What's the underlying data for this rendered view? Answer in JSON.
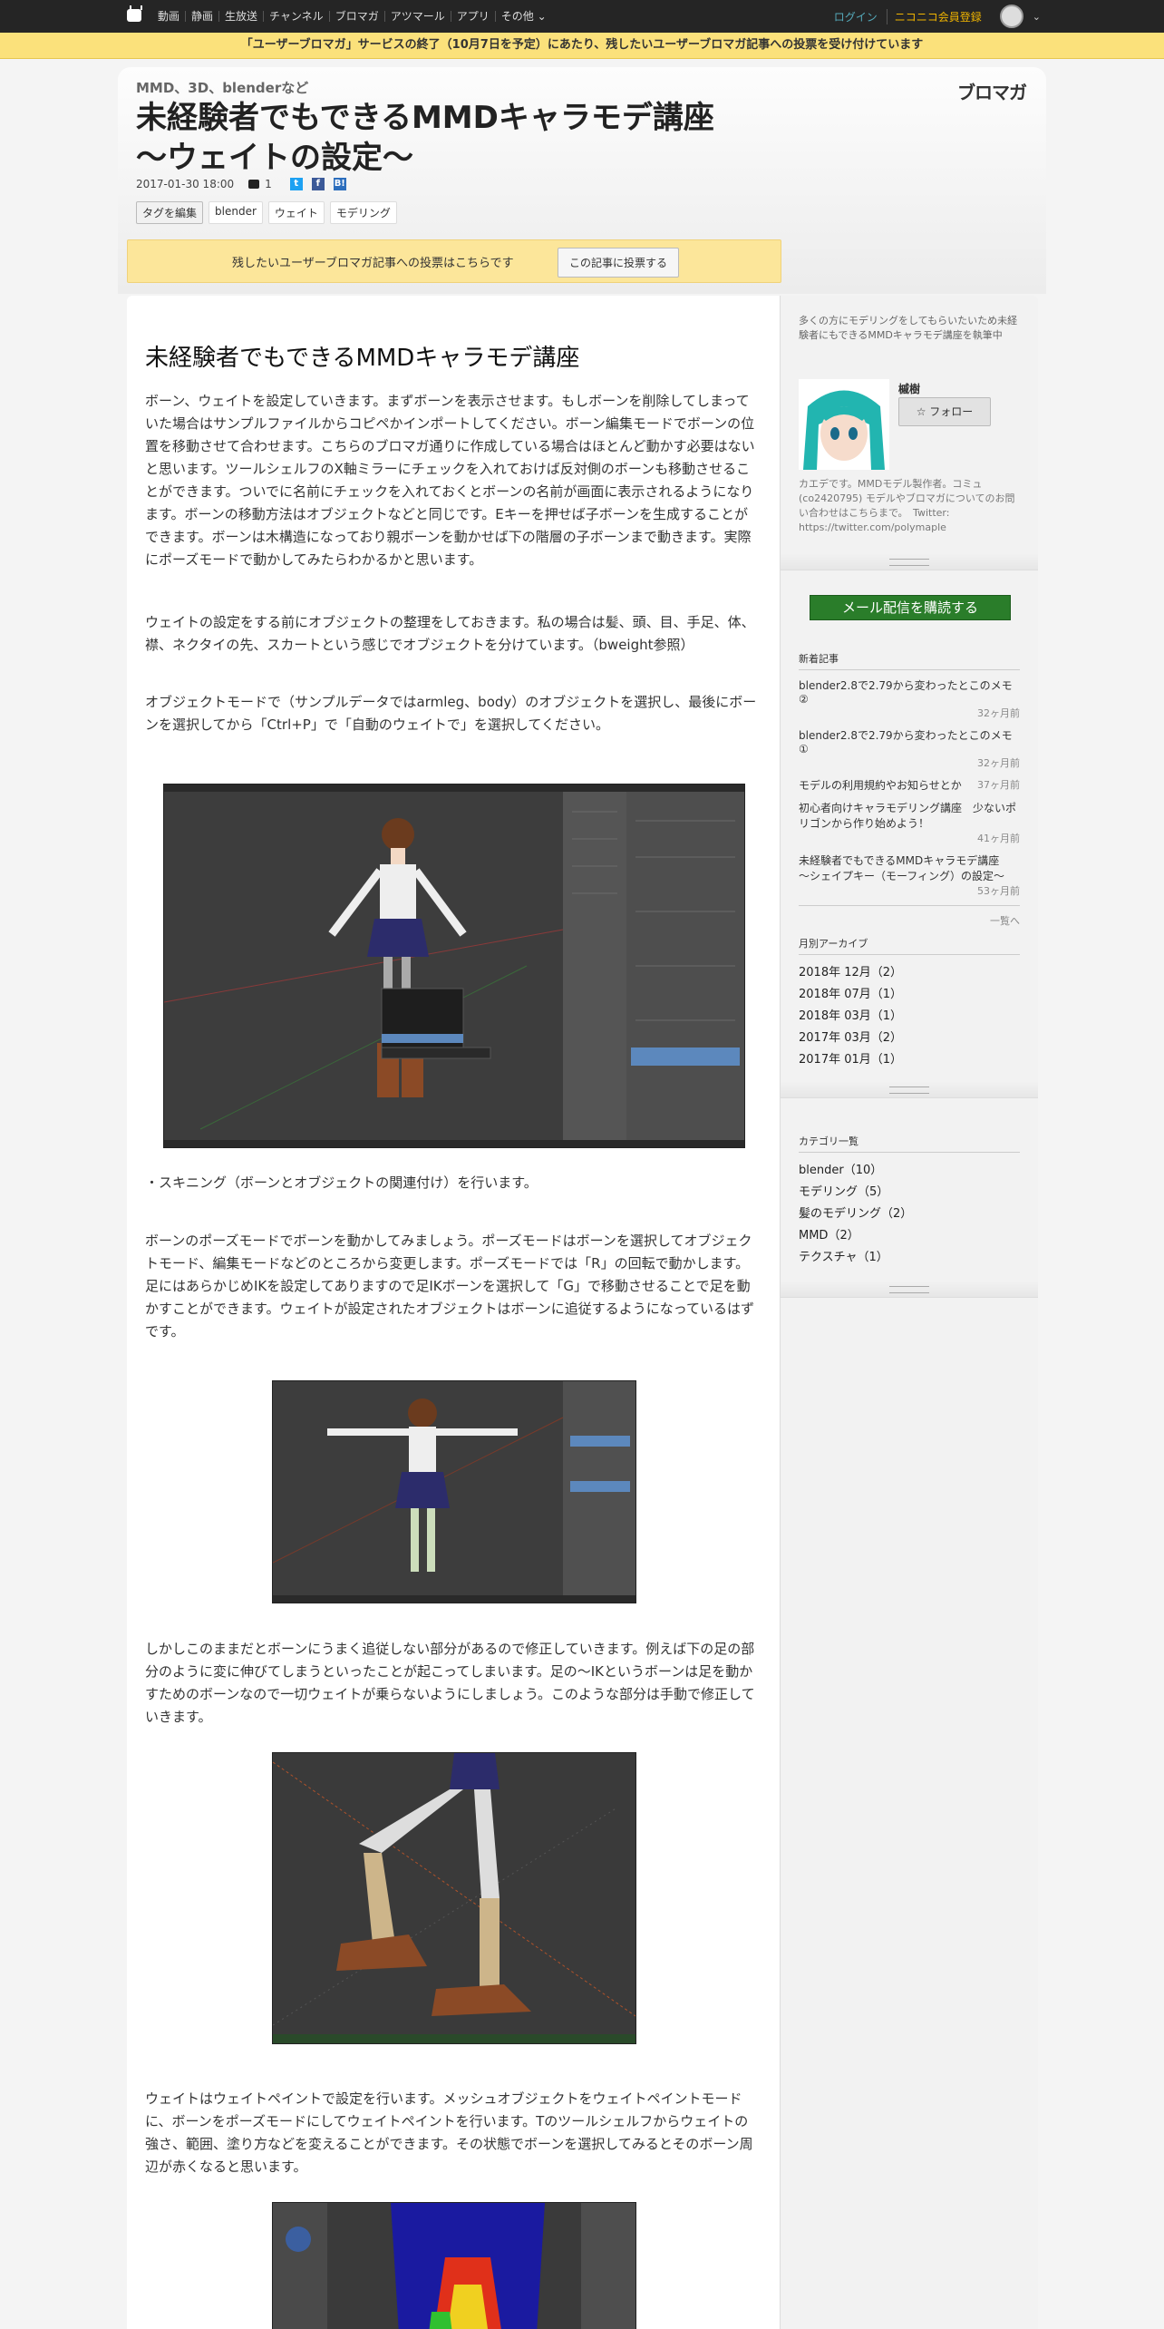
{
  "nav": {
    "links": [
      "動画",
      "静画",
      "生放送",
      "チャンネル",
      "ブロマガ",
      "アツマール",
      "アプリ",
      "その他"
    ],
    "login": "ログイン",
    "signup": "ニコニコ会員登録"
  },
  "notice": "「ユーザーブロマガ」サービスの終了（10月7日を予定）にあたり、残したいユーザーブロマガ記事への投票を受け付けています",
  "header": {
    "kicker": "MMD、3D、blenderなど",
    "logo": "ブロマガ",
    "title": "未経験者でもできるMMDキャラモデ講座　～ウェイトの設定～",
    "date": "2017-01-30 18:00",
    "comments": "1",
    "share": {
      "twitter": "t",
      "facebook": "f",
      "hatena": "B!"
    },
    "tag_edit": "タグを編集",
    "tags": [
      "blender",
      "ウェイト",
      "モデリング"
    ]
  },
  "vote": {
    "text": "残したいユーザーブロマガ記事への投票はこちらです",
    "button": "この記事に投票する"
  },
  "article": {
    "heading": "未経験者でもできるMMDキャラモデ講座",
    "p1": "ボーン、ウェイトを設定していきます。まずボーンを表示させます。もしボーンを削除してしまっていた場合はサンプルファイルからコピペかインポートしてください。ボーン編集モードでボーンの位置を移動させて合わせます。こちらのブロマガ通りに作成している場合はほとんど動かす必要はないと思います。ツールシェルフのX軸ミラーにチェックを入れておけば反対側のボーンも移動させることができます。ついでに名前にチェックを入れておくとボーンの名前が画面に表示されるようになります。ボーンの移動方法はオブジェクトなどと同じです。Eキーを押せば子ボーンを生成することができます。ボーンは木構造になっており親ボーンを動かせば下の階層の子ボーンまで動きます。実際にポーズモードで動かしてみたらわかるかと思います。",
    "p2": "ウェイトの設定をする前にオブジェクトの整理をしておきます。私の場合は髪、頭、目、手足、体、襟、ネクタイの先、スカートという感じでオブジェクトを分けています。（bweight参照）",
    "p3": "オブジェクトモードで（サンプルデータではarmleg、body）のオブジェクトを選択し、最後にボーンを選択してから「Ctrl+P」で「自動のウェイトで」を選択してください。",
    "p4": "・スキニング（ボーンとオブジェクトの関連付け）を行います。",
    "p5": "ボーンのポーズモードでボーンを動かしてみましょう。ポーズモードはボーンを選択してオブジェクトモード、編集モードなどのところから変更します。ポーズモードでは「R」の回転で動かします。足にはあらかじめIKを設定してありますので足IKボーンを選択して「G」で移動させることで足を動かすことができます。ウェイトが設定されたオブジェクトはボーンに追従するようになっているはずです。",
    "p6": "しかしこのままだとボーンにうまく追従しない部分があるので修正していきます。例えば下の足の部分のように変に伸びてしまうといったことが起こってしまいます。足の～IKというボーンは足を動かすためのボーンなので一切ウェイトが乗らないようにしましょう。このような部分は手動で修正していきます。",
    "p7": "ウェイトはウェイトペイントで設定を行います。メッシュオブジェクトをウェイトペイントモードに、ボーンをポーズモードにしてウェイトペイントを行います。Tのツールシェルフからウェイトの強さ、範囲、塗り方などを変えることができます。その状態でボーンを選択してみるとそのボーン周辺が赤くなると思います。"
  },
  "sidebar": {
    "intro": "多くの方にモデリングをしてもらいたいため未経験者にもできるMMDキャラモデ講座を執筆中",
    "author_name": "槭樹",
    "follow": "フォロー",
    "bio": "カエデです。MMDモデル製作者。コミュ(co2420795) モデルやブロマガについてのお問い合わせはこちらまで。　Twitter: https://twitter.com/polymaple",
    "mail_button": "メール配信を購読する",
    "news_title": "新着記事",
    "news": [
      {
        "title": "blender2.8で2.79から変わったとこのメモ②",
        "ago": "32ヶ月前"
      },
      {
        "title": "blender2.8で2.79から変わったとこのメモ①",
        "ago": "32ヶ月前"
      },
      {
        "title": "モデルの利用規約やお知らせとか",
        "ago": "37ヶ月前"
      },
      {
        "title": "初心者向けキャラモデリング講座　少ないポリゴンから作り始めよう！",
        "ago": "41ヶ月前"
      },
      {
        "title": "未経験者でもできるMMDキャラモデ講座　～シェイプキー（モーフィング）の設定～",
        "ago": "53ヶ月前"
      }
    ],
    "news_more": "一覧へ",
    "archive_title": "月別アーカイブ",
    "archive": [
      "2018年 12月（2）",
      "2018年 07月（1）",
      "2018年 03月（1）",
      "2017年 03月（2）",
      "2017年 01月（1）"
    ],
    "category_title": "カテゴリ一覧",
    "categories": [
      "blender（10）",
      "モデリング（5）",
      "髪のモデリング（2）",
      "MMD（2）",
      "テクスチャ（1）"
    ]
  }
}
